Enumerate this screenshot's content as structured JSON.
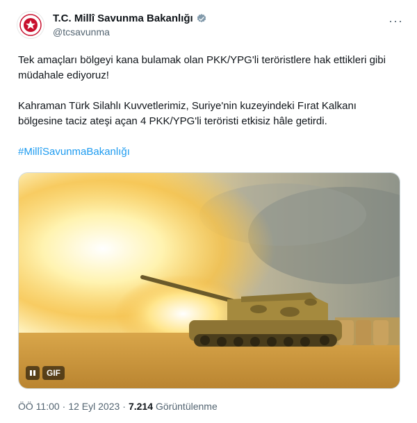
{
  "account": {
    "display_name": "T.C. Millî Savunma Bakanlığı",
    "handle": "@tcsavunma",
    "verified": true,
    "avatar_icon": "mod-emblem-icon",
    "more_icon": "more-options-icon"
  },
  "tweet": {
    "paragraph1": "Tek amaçları bölgeyi kana bulamak olan PKK/YPG'li teröristlere hak ettikleri gibi müdahale ediyoruz!",
    "paragraph2": "Kahraman Türk Silahlı Kuvvetlerimiz, Suriye'nin kuzeyindeki Fırat Kalkanı bölgesine taciz ateşi açan 4 PKK/YPG'li teröristi etkisiz hâle getirdi.",
    "hashtag": "#MillîSavunmaBakanlığı"
  },
  "media": {
    "type": "gif",
    "gif_badge": "GIF",
    "pause_icon": "pause-icon"
  },
  "meta": {
    "time": "ÖÖ 11:00",
    "sep1": "·",
    "date": "12 Eyl 2023",
    "sep2": "·",
    "views": "7.214",
    "views_label": "Görüntülenme"
  },
  "colors": {
    "link": "#1d9bf0",
    "verified": "#829aab",
    "secondary_text": "#536471"
  }
}
